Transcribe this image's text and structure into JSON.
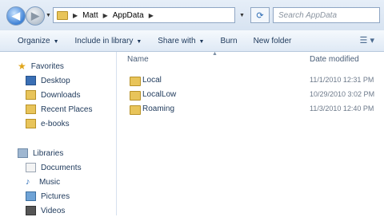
{
  "address": {
    "crumbs": [
      "Matt",
      "AppData"
    ],
    "search_placeholder": "Search AppData"
  },
  "toolbar": {
    "organize": "Organize",
    "include": "Include in library",
    "share": "Share with",
    "burn": "Burn",
    "new_folder": "New folder"
  },
  "nav": {
    "favorites": "Favorites",
    "fav_items": [
      "Desktop",
      "Downloads",
      "Recent Places",
      "e-books"
    ],
    "libraries": "Libraries",
    "lib_items": [
      "Documents",
      "Music",
      "Pictures",
      "Videos"
    ]
  },
  "columns": {
    "name": "Name",
    "date": "Date modified"
  },
  "files": [
    {
      "name": "Local",
      "date": "11/1/2010 12:31 PM"
    },
    {
      "name": "LocalLow",
      "date": "10/29/2010 3:02 PM"
    },
    {
      "name": "Roaming",
      "date": "11/3/2010 12:40 PM"
    }
  ]
}
